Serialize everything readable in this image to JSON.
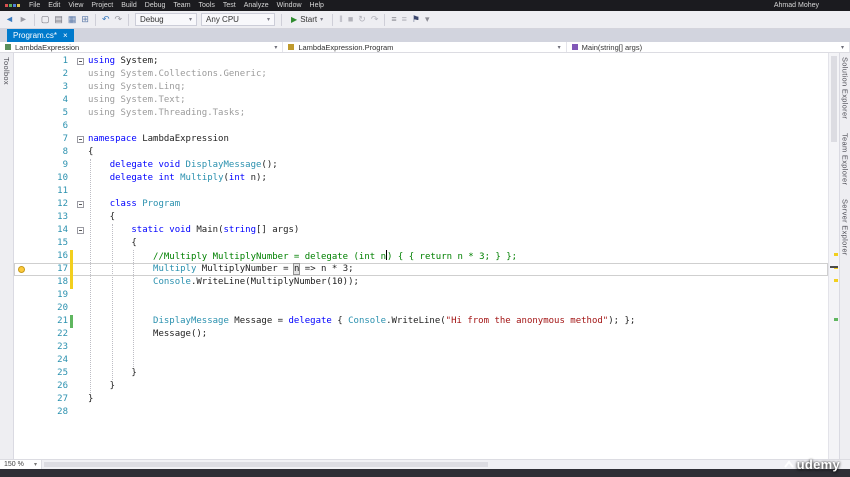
{
  "colors": {
    "accent": "#007acc",
    "keyword": "#0000ff",
    "type": "#2b91af",
    "comment": "#008000",
    "string": "#a31515",
    "line_number": "#2b91af",
    "change_mark_yellow": "#f2cf1e",
    "change_mark_green": "#5fb65f"
  },
  "titlebar": {
    "menu": [
      "File",
      "Edit",
      "View",
      "Project",
      "Build",
      "Debug",
      "Team",
      "Tools",
      "Test",
      "Analyze",
      "Window",
      "Help"
    ],
    "user": "Ahmad Mohey"
  },
  "toolbar": {
    "nav_icons": [
      {
        "name": "back-icon",
        "g": "◄",
        "c": "#3a7bbf"
      },
      {
        "name": "forward-icon",
        "g": "►",
        "c": "#9a9aa2"
      }
    ],
    "file_icons": [
      {
        "name": "new-file-icon",
        "g": "▢",
        "c": "#70707a"
      },
      {
        "name": "open-file-icon",
        "g": "▤",
        "c": "#70707a"
      },
      {
        "name": "save-icon",
        "g": "▦",
        "c": "#5b79a8"
      },
      {
        "name": "save-all-icon",
        "g": "⊞",
        "c": "#5b79a8"
      }
    ],
    "undo_icons": [
      {
        "name": "undo-icon",
        "g": "↶",
        "c": "#3a7bbf"
      },
      {
        "name": "redo-icon",
        "g": "↷",
        "c": "#9a9aa2"
      }
    ],
    "debug_dropdown": "Debug",
    "cpu_dropdown": "Any CPU",
    "start_label": "Start",
    "debug_icons": [
      {
        "name": "pause-icon",
        "g": "‖",
        "c": "#b2b2ba"
      },
      {
        "name": "stop-icon",
        "g": "■",
        "c": "#b2b2ba"
      },
      {
        "name": "restart-icon",
        "g": "↻",
        "c": "#b2b2ba"
      },
      {
        "name": "step-over-icon",
        "g": "↷",
        "c": "#b2b2ba"
      }
    ],
    "misc_icons": [
      {
        "name": "comment-icon",
        "g": "≡",
        "c": "#8a8a92"
      },
      {
        "name": "uncomment-icon",
        "g": "≡",
        "c": "#b2b2ba"
      },
      {
        "name": "bookmark-icon",
        "g": "⚑",
        "c": "#3c486e"
      },
      {
        "name": "options-chevron-icon",
        "g": "▾",
        "c": "#8a8a92"
      }
    ]
  },
  "tabstrip": {
    "tabs": [
      {
        "label": "Program.cs*",
        "active": true,
        "close_glyph": "×"
      }
    ]
  },
  "breadcrumb": {
    "segments": [
      {
        "icon": "project-icon",
        "color": "#5c8f5c",
        "label": "LambdaExpression"
      },
      {
        "icon": "class-icon",
        "color": "#bf9a2c",
        "label": "LambdaExpression.Program"
      },
      {
        "icon": "method-icon",
        "color": "#8158b8",
        "label": "Main(string[] args)"
      }
    ]
  },
  "left_tabs": [
    "Toolbox"
  ],
  "right_tabs": [
    "Solution Explorer",
    "Team Explorer",
    "Server Explorer"
  ],
  "editor": {
    "lines": [
      {
        "n": 1,
        "fold": true,
        "tokens": [
          {
            "c": "kw",
            "t": "using"
          },
          {
            "c": "pl",
            "t": " System;"
          }
        ]
      },
      {
        "n": 2,
        "tokens": [
          {
            "c": "gray",
            "t": "using System.Collections.Generic;"
          }
        ]
      },
      {
        "n": 3,
        "tokens": [
          {
            "c": "gray",
            "t": "using System.Linq;"
          }
        ]
      },
      {
        "n": 4,
        "tokens": [
          {
            "c": "gray",
            "t": "using System.Text;"
          }
        ]
      },
      {
        "n": 5,
        "tokens": [
          {
            "c": "gray",
            "t": "using System.Threading.Tasks;"
          }
        ]
      },
      {
        "n": 6,
        "tokens": []
      },
      {
        "n": 7,
        "fold": true,
        "tokens": [
          {
            "c": "kw",
            "t": "namespace"
          },
          {
            "c": "pl",
            "t": " LambdaExpression"
          }
        ]
      },
      {
        "n": 8,
        "tokens": [
          {
            "c": "pl",
            "t": "{"
          }
        ]
      },
      {
        "n": 9,
        "tokens": [
          {
            "c": "pl",
            "t": "    "
          },
          {
            "c": "kw",
            "t": "delegate void "
          },
          {
            "c": "ty",
            "t": "DisplayMessage"
          },
          {
            "c": "pl",
            "t": "();"
          }
        ]
      },
      {
        "n": 10,
        "tokens": [
          {
            "c": "pl",
            "t": "    "
          },
          {
            "c": "kw",
            "t": "delegate int "
          },
          {
            "c": "ty",
            "t": "Multiply"
          },
          {
            "c": "pl",
            "t": "("
          },
          {
            "c": "kw",
            "t": "int"
          },
          {
            "c": "pl",
            "t": " n);"
          }
        ]
      },
      {
        "n": 11,
        "tokens": []
      },
      {
        "n": 12,
        "fold": true,
        "tokens": [
          {
            "c": "pl",
            "t": "    "
          },
          {
            "c": "kw",
            "t": "class "
          },
          {
            "c": "ty",
            "t": "Program"
          }
        ]
      },
      {
        "n": 13,
        "tokens": [
          {
            "c": "pl",
            "t": "    {"
          }
        ]
      },
      {
        "n": 14,
        "fold": true,
        "tokens": [
          {
            "c": "pl",
            "t": "        "
          },
          {
            "c": "kw",
            "t": "static void "
          },
          {
            "c": "pl",
            "t": "Main("
          },
          {
            "c": "kw",
            "t": "string"
          },
          {
            "c": "pl",
            "t": "[] args)"
          }
        ]
      },
      {
        "n": 15,
        "tokens": [
          {
            "c": "pl",
            "t": "        {"
          }
        ]
      },
      {
        "n": 16,
        "mark": "yellow",
        "tokens": [
          {
            "c": "pl",
            "t": "            "
          },
          {
            "c": "cm",
            "t": "//Multiply MultiplyNumber = delegate (int n"
          },
          {
            "c": "caret",
            "t": ""
          },
          {
            "c": "cm",
            "t": ") { { return n * 3; } };"
          }
        ]
      },
      {
        "n": 17,
        "mark": "yellow",
        "bulb": true,
        "current": true,
        "tokens": [
          {
            "c": "pl",
            "t": "            "
          },
          {
            "c": "ty",
            "t": "Multiply"
          },
          {
            "c": "pl",
            "t": " MultiplyNumber = "
          },
          {
            "c": "hl",
            "t": "n"
          },
          {
            "c": "pl",
            "t": " => n * 3;"
          }
        ]
      },
      {
        "n": 18,
        "mark": "yellow",
        "tokens": [
          {
            "c": "pl",
            "t": "            "
          },
          {
            "c": "ty",
            "t": "Console"
          },
          {
            "c": "pl",
            "t": ".WriteLine(MultiplyNumber(10));"
          }
        ]
      },
      {
        "n": 19,
        "tokens": []
      },
      {
        "n": 20,
        "tokens": []
      },
      {
        "n": 21,
        "mark": "green",
        "tokens": [
          {
            "c": "pl",
            "t": "            "
          },
          {
            "c": "ty",
            "t": "DisplayMessage"
          },
          {
            "c": "pl",
            "t": " Message = "
          },
          {
            "c": "kw",
            "t": "delegate"
          },
          {
            "c": "pl",
            "t": " { "
          },
          {
            "c": "ty",
            "t": "Console"
          },
          {
            "c": "pl",
            "t": ".WriteLine("
          },
          {
            "c": "str",
            "t": "\"Hi from the anonymous method\""
          },
          {
            "c": "pl",
            "t": "); };"
          }
        ]
      },
      {
        "n": 22,
        "tokens": [
          {
            "c": "pl",
            "t": "            Message();"
          }
        ]
      },
      {
        "n": 23,
        "tokens": []
      },
      {
        "n": 24,
        "tokens": []
      },
      {
        "n": 25,
        "tokens": [
          {
            "c": "pl",
            "t": "        }"
          }
        ]
      },
      {
        "n": 26,
        "tokens": [
          {
            "c": "pl",
            "t": "    }"
          }
        ]
      },
      {
        "n": 27,
        "tokens": [
          {
            "c": "pl",
            "t": "}"
          }
        ]
      },
      {
        "n": 28,
        "tokens": []
      }
    ],
    "guides": [
      {
        "col": 0,
        "from": 9,
        "to": 26
      },
      {
        "col": 4,
        "from": 14,
        "to": 25
      },
      {
        "col": 8,
        "from": 16,
        "to": 24
      }
    ],
    "scroll_marks": [
      {
        "line": 16,
        "color": "#f2cf1e",
        "kind": "change"
      },
      {
        "line": 17,
        "color": "#f2cf1e",
        "kind": "change"
      },
      {
        "line": 18,
        "color": "#f2cf1e",
        "kind": "change"
      },
      {
        "line": 21,
        "color": "#5fb65f",
        "kind": "change"
      },
      {
        "line": 17,
        "color": "#4a4a4a",
        "kind": "caret"
      }
    ]
  },
  "statusbar": {
    "zoom": "150 %"
  },
  "watermark": {
    "label": "udemy"
  }
}
